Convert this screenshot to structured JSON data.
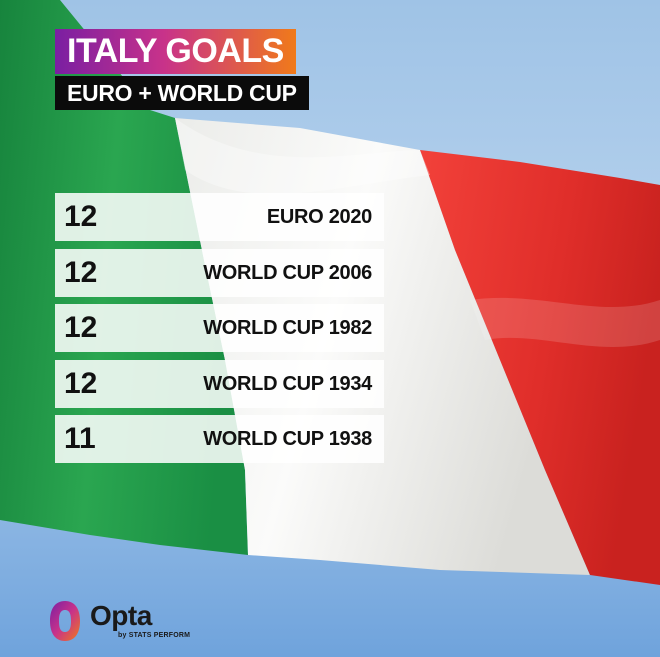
{
  "header": {
    "title": "ITALY GOALS",
    "subtitle": "EURO + WORLD CUP"
  },
  "chart_data": {
    "type": "table",
    "title": "ITALY GOALS",
    "subtitle": "EURO + WORLD CUP",
    "rows": [
      {
        "value": 12,
        "label": "EURO 2020"
      },
      {
        "value": 12,
        "label": "WORLD CUP 2006"
      },
      {
        "value": 12,
        "label": "WORLD CUP 1982"
      },
      {
        "value": 12,
        "label": "WORLD CUP 1934"
      },
      {
        "value": 11,
        "label": "WORLD CUP 1938"
      }
    ]
  },
  "brand": {
    "name": "Opta",
    "tagline": "by STATS PERFORM",
    "colors": {
      "purple": "#7a1fa2",
      "magenta": "#c8328a",
      "orange": "#f07a1a"
    }
  },
  "flag_colors": {
    "green": "#1f9a4a",
    "white": "#f4f4f2",
    "red": "#e3312e"
  }
}
